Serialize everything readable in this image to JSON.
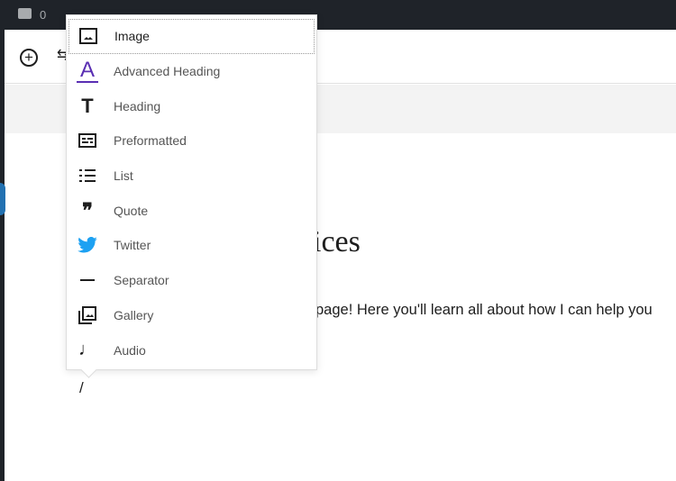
{
  "adminbar": {
    "comments_count": "0"
  },
  "editor": {
    "title_fragment": "vices",
    "paragraph_fragment": "es page! Here you'll learn all about how I can help you",
    "slash_input": "/"
  },
  "inserter": {
    "items": [
      {
        "label": "Image",
        "icon": "image-icon"
      },
      {
        "label": "Advanced Heading",
        "icon": "advanced-heading-icon",
        "color": "#5a2fb3"
      },
      {
        "label": "Heading",
        "icon": "heading-icon"
      },
      {
        "label": "Preformatted",
        "icon": "preformatted-icon"
      },
      {
        "label": "List",
        "icon": "list-icon"
      },
      {
        "label": "Quote",
        "icon": "quote-icon"
      },
      {
        "label": "Twitter",
        "icon": "twitter-icon",
        "color": "#1da1f2"
      },
      {
        "label": "Separator",
        "icon": "separator-icon"
      },
      {
        "label": "Gallery",
        "icon": "gallery-icon"
      },
      {
        "label": "Audio",
        "icon": "audio-icon"
      }
    ]
  }
}
